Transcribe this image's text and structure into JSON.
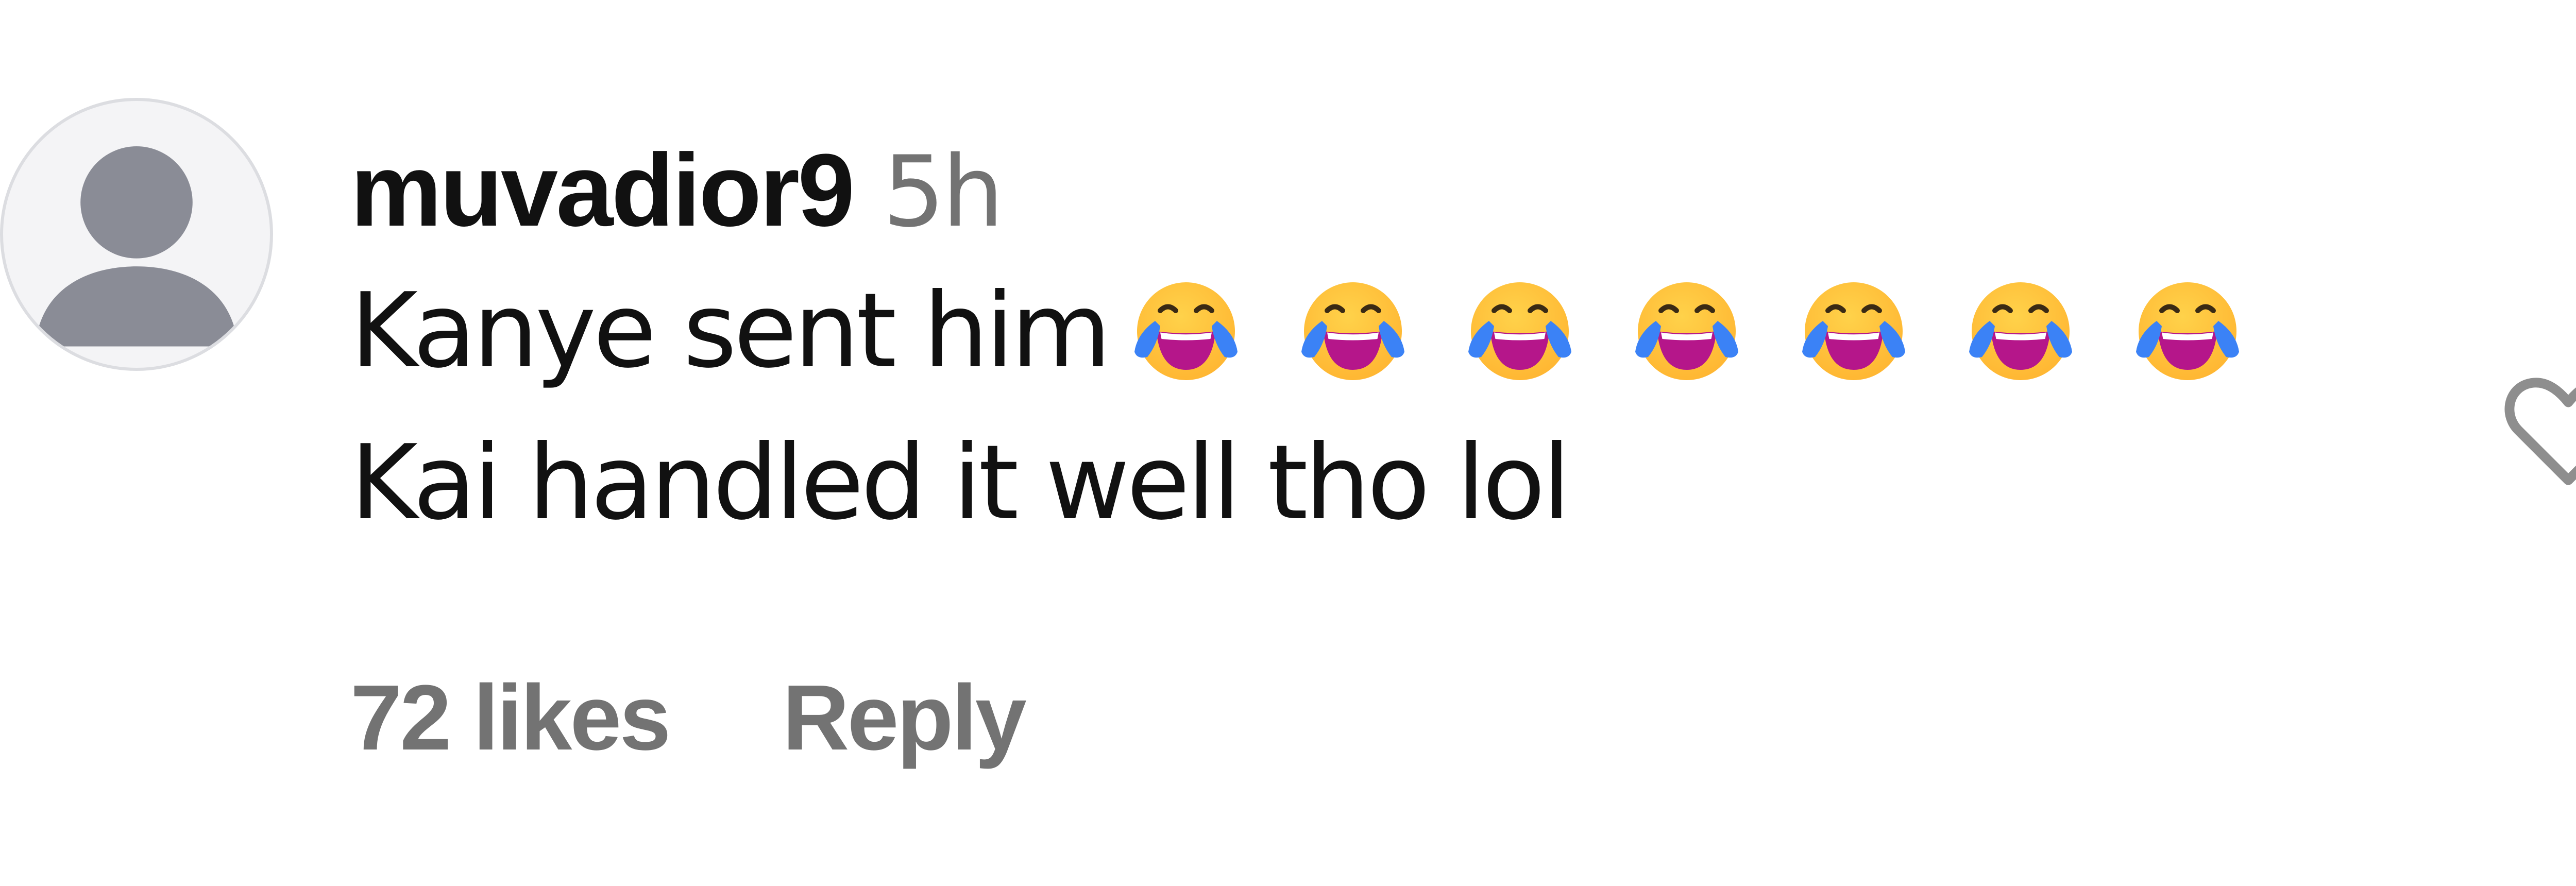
{
  "comment": {
    "username": "muvadior9",
    "timestamp": "5h",
    "text_line_1": "Kanye sent him",
    "emoji_count": 7,
    "emoji_icon": "face-with-tears-of-joy-icon",
    "text_line_2": "Kai handled it well tho lol",
    "likes_label": "72 likes",
    "reply_label": "Reply"
  },
  "colors": {
    "primary_text": "#111111",
    "secondary_text": "#737373",
    "avatar_background": "#f4f4f6",
    "avatar_silhouette": "#8a8c96",
    "heart_outline": "#8e8e8e",
    "emoji_face": "#ffb733",
    "emoji_tears": "#3b82f6",
    "emoji_mouth": "#b5168a"
  },
  "icons": {
    "avatar": "default-user-avatar-icon",
    "like": "heart-outline-icon"
  }
}
